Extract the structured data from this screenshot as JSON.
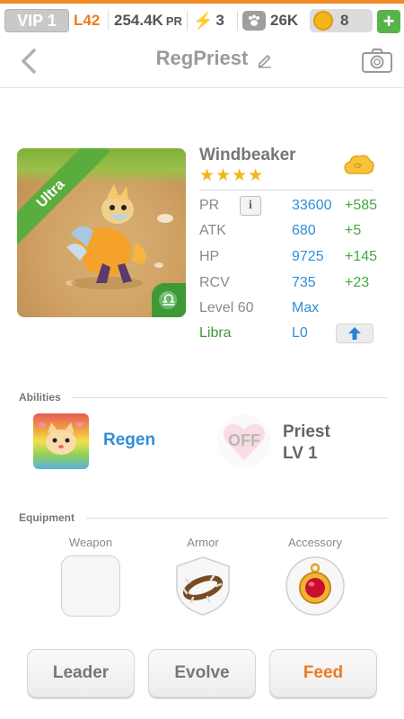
{
  "status_bar": {
    "vip": "VIP 1",
    "level": "L42",
    "pr": "254.4K",
    "pr_unit": "PR",
    "energy": "3",
    "paws": "26K",
    "gems": "8",
    "add_label": "+",
    "accent_color": "#f08a24"
  },
  "header": {
    "title": "RegPriest"
  },
  "monster": {
    "name": "Windbeaker",
    "rarity": "Ultra",
    "stars": "★★★★",
    "star_count": 4,
    "zodiac_symbol": "♎",
    "stats": [
      {
        "label": "PR",
        "value": "33600",
        "bonus": "+585"
      },
      {
        "label": "ATK",
        "value": "680",
        "bonus": "+5"
      },
      {
        "label": "HP",
        "value": "9725",
        "bonus": "+145"
      },
      {
        "label": "RCV",
        "value": "735",
        "bonus": "+23"
      },
      {
        "label": "Level 60",
        "value": "Max",
        "bonus": ""
      },
      {
        "label": "Libra",
        "value": "L0",
        "bonus": ""
      }
    ],
    "info_label": "i"
  },
  "abilities": {
    "section_title": "Abilities",
    "ability_name": "Regen",
    "off_label": "OFF",
    "class_name": "Priest",
    "class_level": "LV 1"
  },
  "equipment": {
    "section_title": "Equipment",
    "slots": [
      {
        "label": "Weapon"
      },
      {
        "label": "Armor"
      },
      {
        "label": "Accessory"
      }
    ]
  },
  "actions": {
    "leader": "Leader",
    "evolve": "Evolve",
    "feed": "Feed"
  }
}
